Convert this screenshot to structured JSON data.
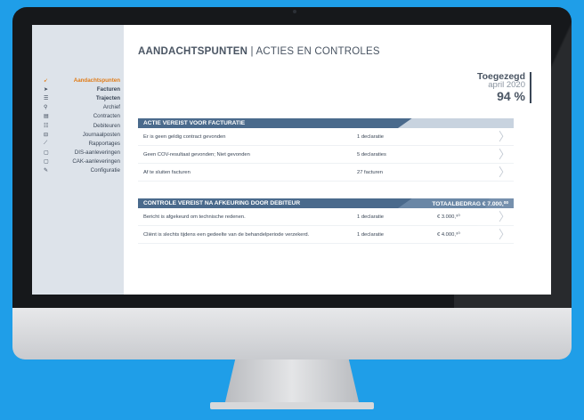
{
  "sidebar": {
    "items": [
      {
        "label": "Aandachtspunten",
        "icon": "megaphone-icon",
        "glyph": "➹"
      },
      {
        "label": "Facturen",
        "icon": "send-icon",
        "glyph": "➤"
      },
      {
        "label": "Trajecten",
        "icon": "list-icon",
        "glyph": "☰"
      },
      {
        "label": "Archief",
        "icon": "search-icon",
        "glyph": "⚲"
      },
      {
        "label": "Contracten",
        "icon": "document-icon",
        "glyph": "▤"
      },
      {
        "label": "Debiteuren",
        "icon": "table-icon",
        "glyph": "☷"
      },
      {
        "label": "Journaalposten",
        "icon": "journal-icon",
        "glyph": "⊟"
      },
      {
        "label": "Rapportages",
        "icon": "chart-icon",
        "glyph": "⟋"
      },
      {
        "label": "DIS-aanleveringen",
        "icon": "file-icon",
        "glyph": "▢"
      },
      {
        "label": "CAK-aanleveringen",
        "icon": "file-icon",
        "glyph": "▢"
      },
      {
        "label": "Configuratie",
        "icon": "wrench-icon",
        "glyph": "✎"
      }
    ]
  },
  "header": {
    "title_bold": "AANDACHTSPUNTEN",
    "separator": "|",
    "title_rest": "ACTIES EN CONTROLES"
  },
  "kpi": {
    "title": "Toegezegd",
    "month": "april 2020",
    "percent": "94 %"
  },
  "panel1": {
    "header": "ACTIE VEREIST VOOR FACTURATIE",
    "rows": [
      {
        "text": "Er is geen geldig contract gevonden",
        "count": "1 declaratie"
      },
      {
        "text": "Geen COV-resultaat gevonden; Niet gevonden",
        "count": "5 declaraties"
      },
      {
        "text": "Af te sluiten facturen",
        "count": "27  facturen"
      }
    ]
  },
  "panel2": {
    "header": "CONTROLE VEREIST NA AFKEURING DOOR DEBITEUR",
    "total": "TOTAALBEDRAG € 7.000,⁰⁰",
    "rows": [
      {
        "text": "Bericht is afgekeurd om technische redenen.",
        "count": "1 declaratie",
        "amount": "€ 3.000,⁹⁰"
      },
      {
        "text": "Cliënt is slechts tijdens een gedeelte van de behandelperiode verzekerd.",
        "count": "1 declaratie",
        "amount": "€ 4.000,⁹⁰"
      }
    ]
  },
  "colors": {
    "accent": "#e07c18",
    "panel_header": "#4a6a8c",
    "background": "#1f9ee8"
  }
}
